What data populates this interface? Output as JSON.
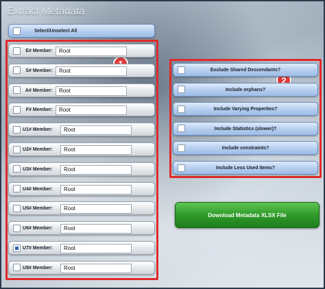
{
  "window": {
    "title": "Extract Metadata"
  },
  "select_all": {
    "label": "Select/Unselect All",
    "checked": false
  },
  "members": [
    {
      "label": "E# Member:",
      "value": "Root",
      "checked": false
    },
    {
      "label": "S# Member:",
      "value": "Root",
      "checked": false
    },
    {
      "label": "A# Member:",
      "value": "Root",
      "checked": false
    },
    {
      "label": "F# Member:",
      "value": "Root",
      "checked": false
    },
    {
      "label": "U1# Member:",
      "value": "Root",
      "checked": false
    },
    {
      "label": "U2# Member:",
      "value": "Root",
      "checked": false
    },
    {
      "label": "U3# Member:",
      "value": "Root",
      "checked": false
    },
    {
      "label": "U4# Member:",
      "value": "Root",
      "checked": false
    },
    {
      "label": "U5# Member:",
      "value": "Root",
      "checked": false
    },
    {
      "label": "U6# Member:",
      "value": "Root",
      "checked": false
    },
    {
      "label": "U7# Member:",
      "value": "Root",
      "checked": true
    },
    {
      "label": "U8# Member:",
      "value": "Root",
      "checked": false
    }
  ],
  "options": [
    {
      "label": "Exclude Shared Descendants?",
      "checked": false
    },
    {
      "label": "Include orphans?",
      "checked": false
    },
    {
      "label": "Include Varying Properties?",
      "checked": false
    },
    {
      "label": "Include Statistics (slower)?",
      "checked": false
    },
    {
      "label": "Include constraints?",
      "checked": false
    },
    {
      "label": "Include Less Used Items?",
      "checked": false
    }
  ],
  "annotations": {
    "badge_1": "1",
    "badge_2": "2"
  },
  "download": {
    "label": "Download Metadata XLSX File"
  },
  "colors": {
    "highlight_frame": "#e02a2a",
    "download_button": "#2f9b2a",
    "option_button": "#b7cff0"
  }
}
